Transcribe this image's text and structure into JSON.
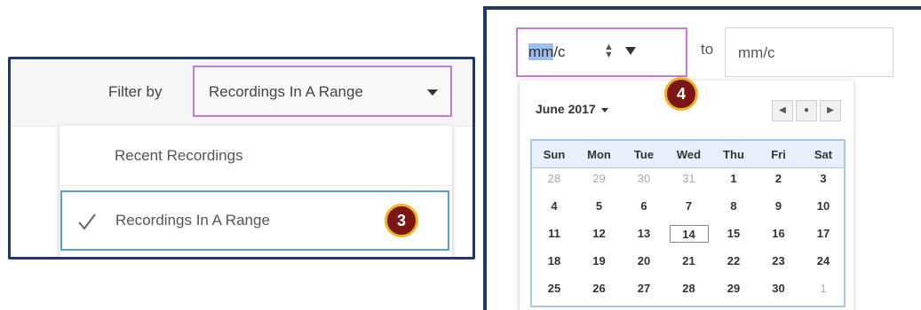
{
  "filter": {
    "label": "Filter by",
    "selected": "Recordings In A Range",
    "options": [
      "Recent Recordings",
      "Recordings In A Range"
    ],
    "step_badge": "3"
  },
  "date_range": {
    "from_selected": "mm",
    "from_rest": "/c",
    "to_label": "to",
    "to_value": "mm/c",
    "step_badge": "4"
  },
  "calendar": {
    "month": "June 2017",
    "weekdays": [
      "Sun",
      "Mon",
      "Tue",
      "Wed",
      "Thu",
      "Fri",
      "Sat"
    ],
    "weeks": [
      [
        "28",
        "29",
        "30",
        "31",
        "1",
        "2",
        "3"
      ],
      [
        "4",
        "5",
        "6",
        "7",
        "8",
        "9",
        "10"
      ],
      [
        "11",
        "12",
        "13",
        "14",
        "15",
        "16",
        "17"
      ],
      [
        "18",
        "19",
        "20",
        "21",
        "22",
        "23",
        "24"
      ],
      [
        "25",
        "26",
        "27",
        "28",
        "29",
        "30",
        "1"
      ]
    ],
    "muted_first_week": [
      "28",
      "29",
      "30",
      "31"
    ],
    "muted_last_week": [
      "1"
    ],
    "today": "14"
  },
  "colors": {
    "panel_border": "#1f3864",
    "highlight_border": "#c37bd4",
    "selected_item_border": "#5b9bd5",
    "badge_fill": "#7a1712",
    "badge_ring": "#f0b323"
  }
}
